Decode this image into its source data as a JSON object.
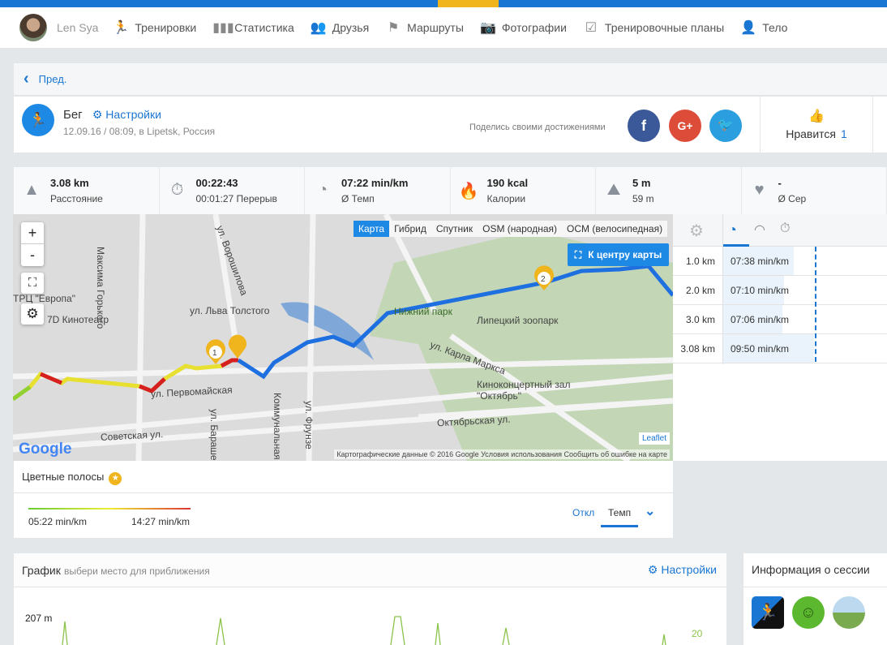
{
  "nav": {
    "user": "Len Sya",
    "items": [
      {
        "label": "Тренировки",
        "icon": "running-icon"
      },
      {
        "label": "Статистика",
        "icon": "bar-chart-icon"
      },
      {
        "label": "Друзья",
        "icon": "friends-icon"
      },
      {
        "label": "Маршруты",
        "icon": "signpost-icon"
      },
      {
        "label": "Фотографии",
        "icon": "camera-icon"
      },
      {
        "label": "Тренировочные планы",
        "icon": "clipboard-icon"
      },
      {
        "label": "Тело",
        "icon": "person-icon"
      }
    ]
  },
  "prev": "Пред.",
  "activity": {
    "sport": "Бег",
    "settings": "Настройки",
    "date": "12.09.16 / 08:09, в Lipetsk, Россия",
    "share": "Поделись своими достижениями",
    "like_label": "Нравится",
    "like_count": "1"
  },
  "stats": [
    {
      "value": "3.08 km",
      "label": "Расстояние"
    },
    {
      "value": "00:22:43",
      "label": "00:01:27 Перерыв"
    },
    {
      "value": "07:22 min/km",
      "label": "Ø Темп"
    },
    {
      "value": "190 kcal",
      "label": "Калории"
    },
    {
      "value": "5 m",
      "label": "59 m"
    },
    {
      "value": "-",
      "label": "Ø Сер"
    }
  ],
  "map": {
    "tabs": [
      "Карта",
      "Гибрид",
      "Спутник",
      "OSM (народная)",
      "OCM (велосипедная)"
    ],
    "active_tab": "Карта",
    "center_btn": "К центру карты",
    "zoom_in": "+",
    "zoom_out": "-",
    "attribution": "Картографические данные © 2016 Google   Условия использования   Сообщить об ошибке на карте",
    "leaflet": "Leaflet",
    "google": "Google",
    "labels": [
      "Советская ул.",
      "ул. Первомайская",
      "ул. Льва Толстого",
      "7D Кинотеатр",
      "Нижний парк",
      "Липецкий зоопарк",
      "ул. Карла Маркса",
      "Киноконцертный зал \"Октябрь\"",
      "Октябрьская ул.",
      "ул. Ворошилова",
      "Максима Горького",
      "ТРЦ \"Европа\"",
      "ул. Фрунзе",
      "ул. Барашева",
      "Коммунальная"
    ],
    "markers": [
      "1",
      "2"
    ]
  },
  "splits": [
    {
      "km": "1.0 km",
      "pace": "07:38 min/km",
      "frac": 0.78
    },
    {
      "km": "2.0 km",
      "pace": "07:10 min/km",
      "frac": 0.67
    },
    {
      "km": "3.0 km",
      "pace": "07:06 min/km",
      "frac": 0.65
    },
    {
      "km": "3.08 km",
      "pace": "09:50 min/km",
      "frac": 1.0
    }
  ],
  "colors": {
    "title": "Цветные полосы",
    "min": "05:22 min/km",
    "max": "14:27 min/km",
    "off": "Откл",
    "pace": "Темп"
  },
  "graph": {
    "title": "График",
    "subtitle": "выбери место для приближения",
    "settings": "Настройки",
    "y_label": "207 m",
    "right_label": "20"
  },
  "info": {
    "title": "Информация о сессии"
  }
}
